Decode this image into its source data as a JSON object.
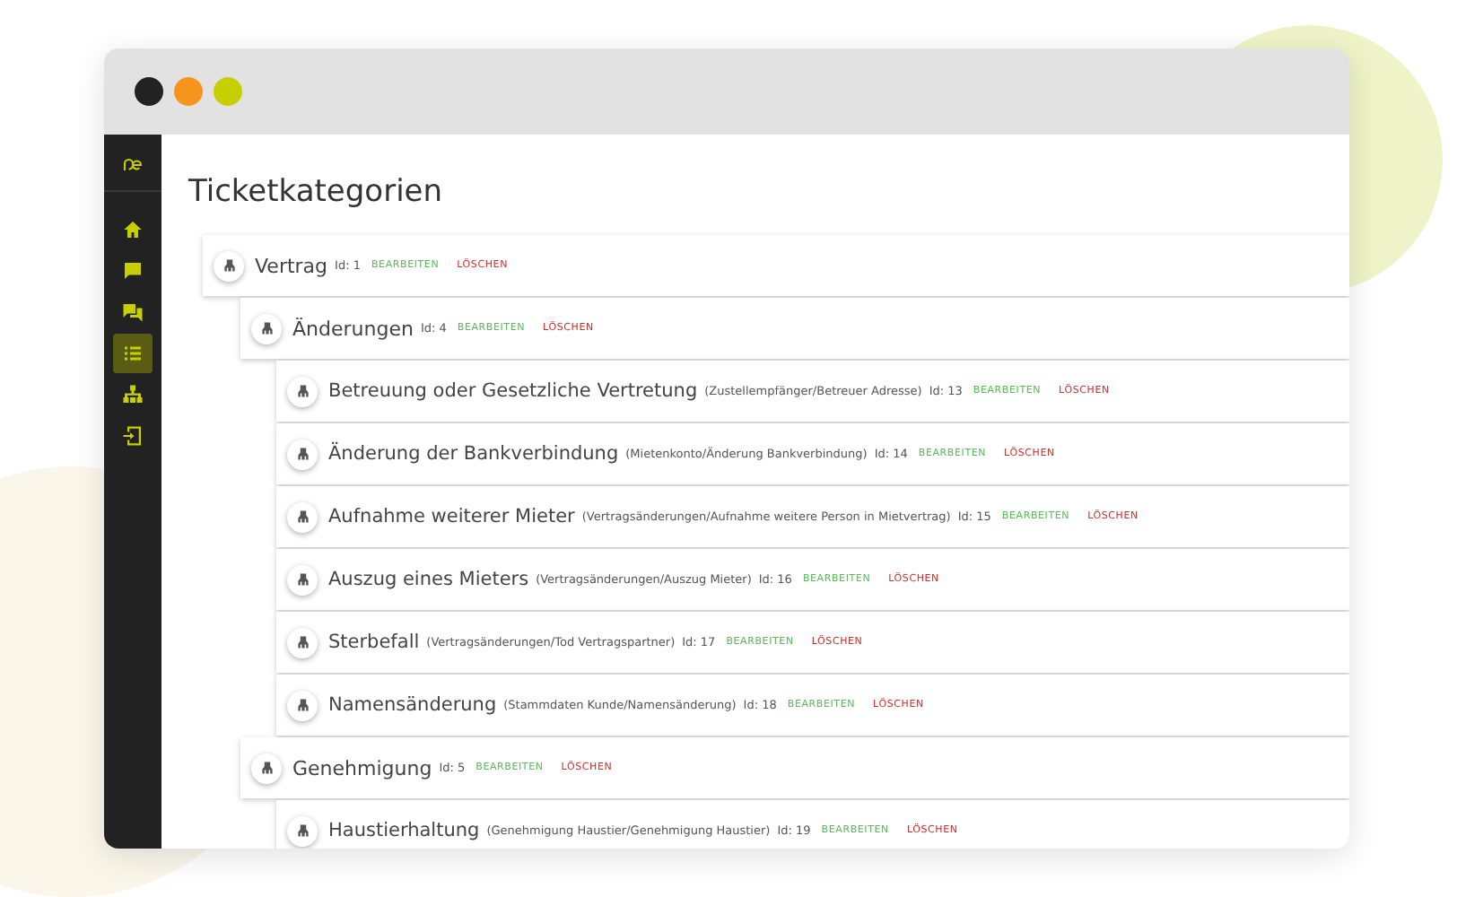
{
  "sidebar": {
    "items": [
      {
        "selected": false
      },
      {
        "selected": false
      },
      {
        "selected": false
      },
      {
        "selected": true
      },
      {
        "selected": false
      },
      {
        "selected": false
      }
    ]
  },
  "page": {
    "title": "Ticketkategorien"
  },
  "categories": [
    {
      "name": "Vertrag",
      "id": "Id: 1",
      "edit": "BEARBEITEN",
      "delete": "LÖSCHEN",
      "children": [
        {
          "name": "Änderungen",
          "id": "Id: 4",
          "edit": "BEARBEITEN",
          "delete": "LÖSCHEN",
          "children": [
            {
              "name": "Betreuung oder Gesetzliche Vertretung",
              "path": "(Zustellempfänger/Betreuer Adresse)",
              "id": "Id: 13",
              "edit": "BEARBEITEN",
              "delete": "LÖSCHEN"
            },
            {
              "name": "Änderung der Bankverbindung",
              "path": "(Mietenkonto/Änderung Bankverbindung)",
              "id": "Id: 14",
              "edit": "BEARBEITEN",
              "delete": "LÖSCHEN"
            },
            {
              "name": "Aufnahme weiterer Mieter",
              "path": "(Vertragsänderungen/Aufnahme weitere Person in Mietvertrag)",
              "id": "Id: 15",
              "edit": "BEARBEITEN",
              "delete": "LÖSCHEN"
            },
            {
              "name": "Auszug eines Mieters",
              "path": "(Vertragsänderungen/Auszug Mieter)",
              "id": "Id: 16",
              "edit": "BEARBEITEN",
              "delete": "LÖSCHEN"
            },
            {
              "name": "Sterbefall",
              "path": "(Vertragsänderungen/Tod Vertragspartner)",
              "id": "Id: 17",
              "edit": "BEARBEITEN",
              "delete": "LÖSCHEN"
            },
            {
              "name": "Namensänderung",
              "path": "(Stammdaten Kunde/Namensänderung)",
              "id": "Id: 18",
              "edit": "BEARBEITEN",
              "delete": "LÖSCHEN"
            }
          ]
        },
        {
          "name": "Genehmigung",
          "id": "Id: 5",
          "edit": "BEARBEITEN",
          "delete": "LÖSCHEN",
          "children": [
            {
              "name": "Haustierhaltung",
              "path": "(Genehmigung Haustier/Genehmigung Haustier)",
              "id": "Id: 19",
              "edit": "BEARBEITEN",
              "delete": "LÖSCHEN"
            }
          ]
        }
      ]
    }
  ]
}
